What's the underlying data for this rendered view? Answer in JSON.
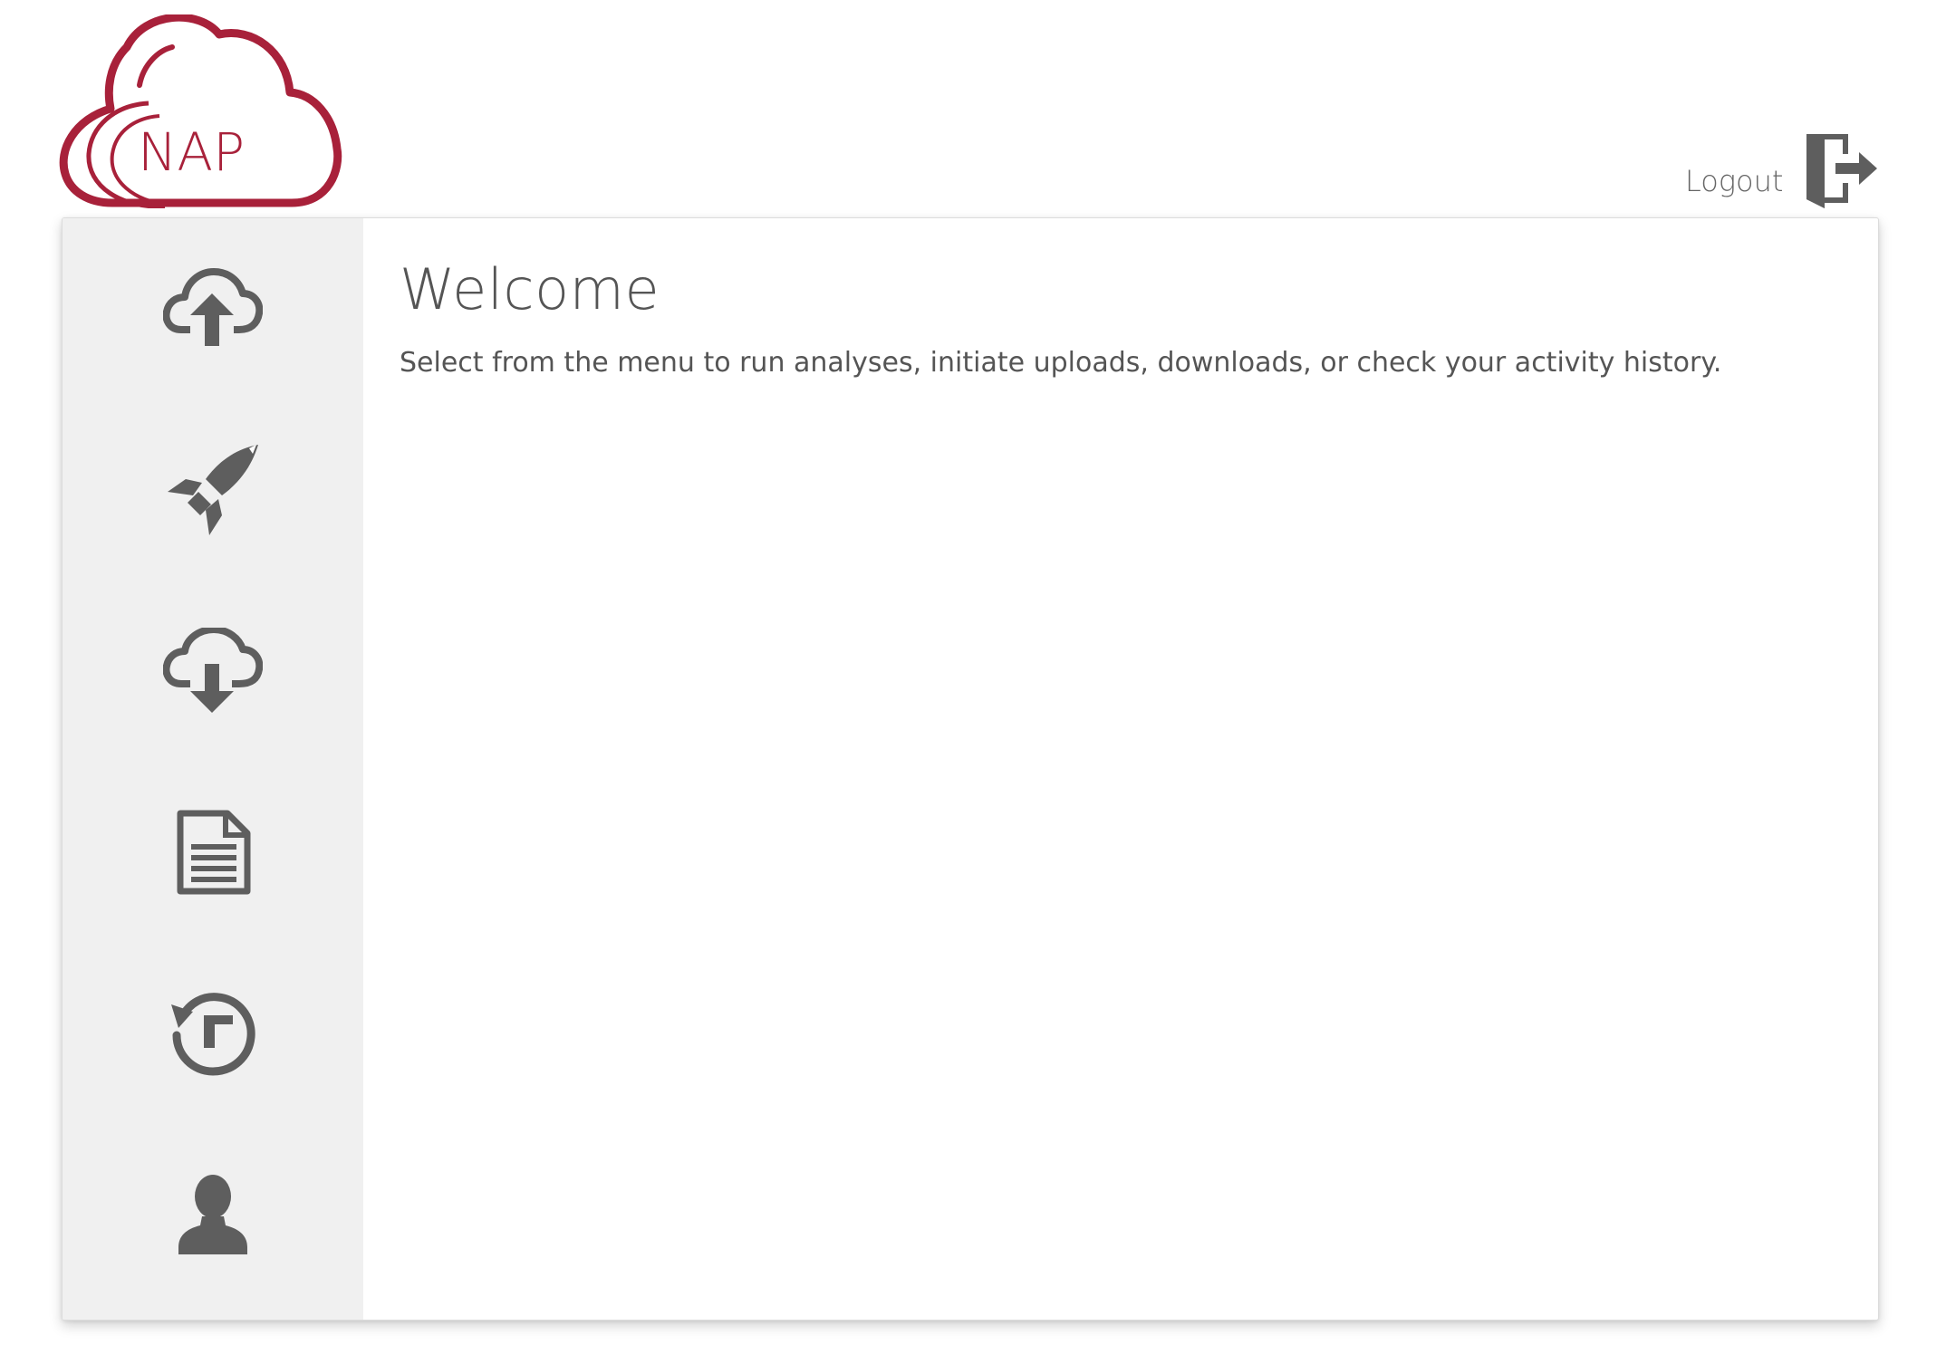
{
  "brand": {
    "logo_text": "NAP",
    "logo_color": "#a8213a"
  },
  "header": {
    "logout_label": "Logout"
  },
  "sidebar": {
    "icon_color": "#5e5e5e",
    "items": [
      {
        "icon": "cloud-upload-icon"
      },
      {
        "icon": "rocket-icon"
      },
      {
        "icon": "cloud-download-icon"
      },
      {
        "icon": "document-icon"
      },
      {
        "icon": "history-icon"
      },
      {
        "icon": "user-icon"
      }
    ]
  },
  "main": {
    "title": "Welcome",
    "description": "Select from the menu to run analyses, initiate uploads, downloads, or check your activity history."
  }
}
